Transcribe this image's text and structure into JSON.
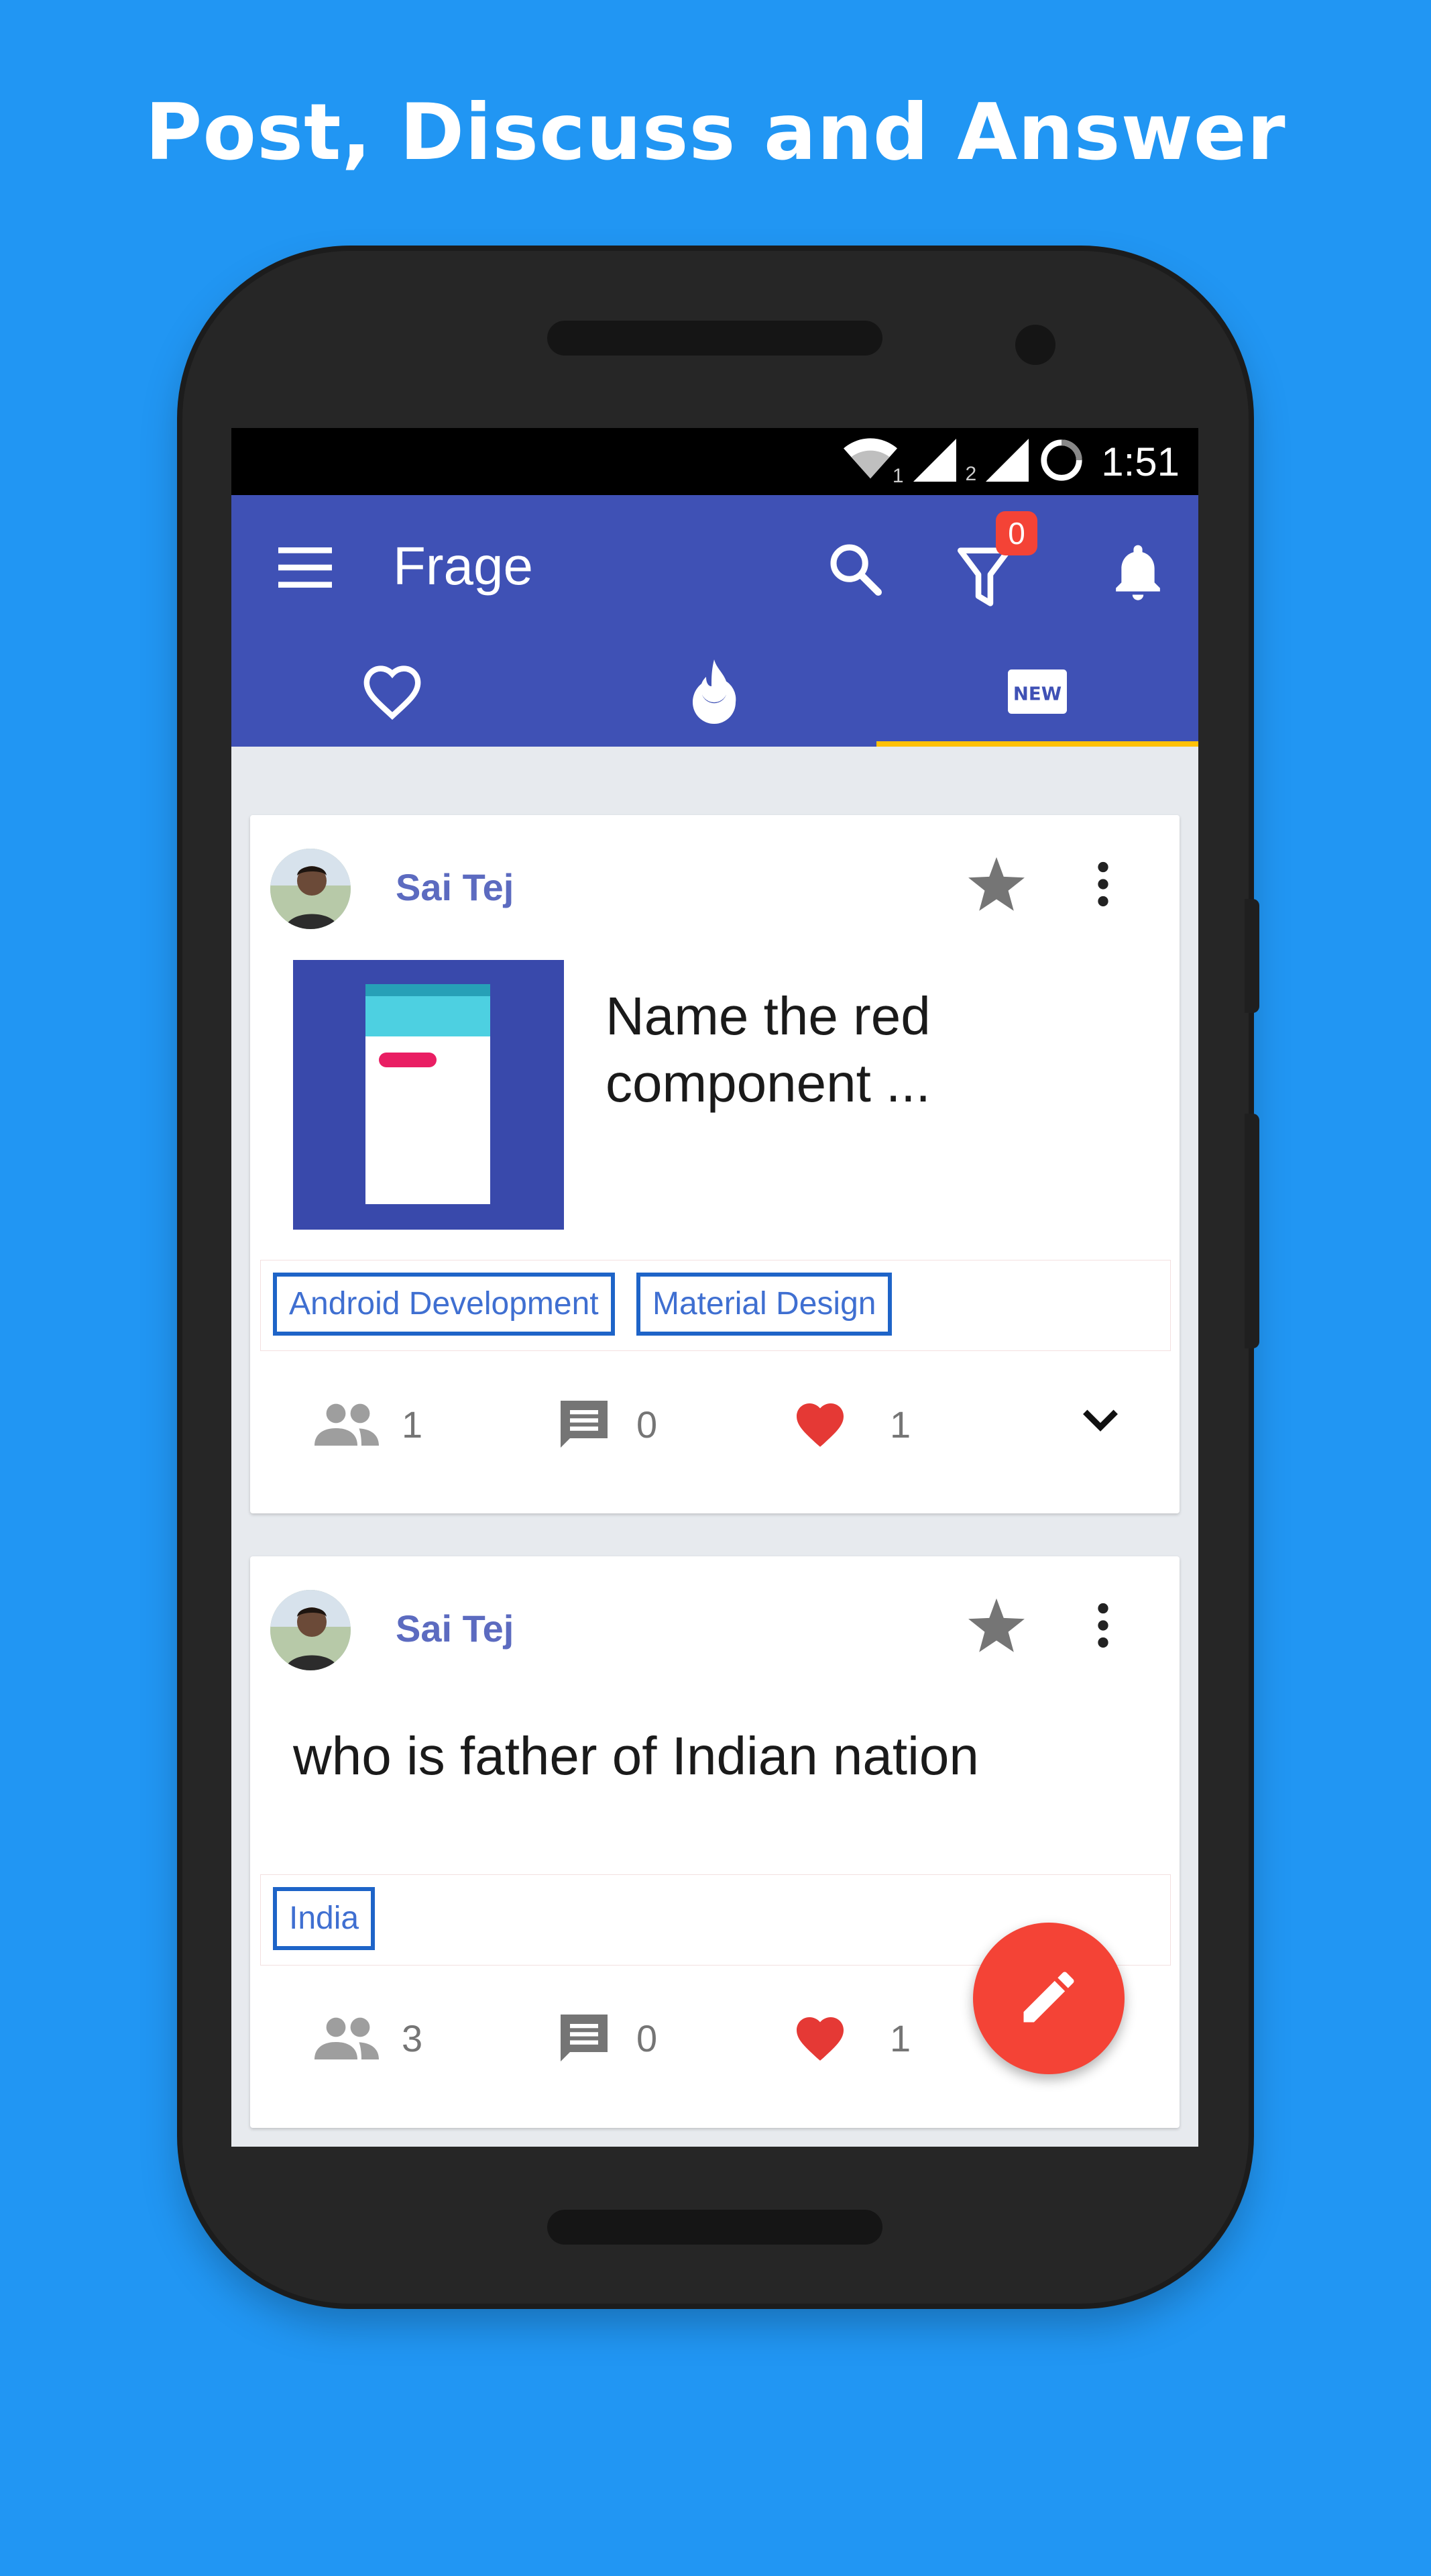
{
  "headline": "Post, Discuss and Answer",
  "status_bar": {
    "wifi_label": "1",
    "sim2_label": "2",
    "time": "1:51"
  },
  "toolbar": {
    "title": "Frage",
    "filter_badge": "0",
    "color": "#3F51B5"
  },
  "tabs": [
    {
      "icon": "heart-outline-icon"
    },
    {
      "icon": "fire-icon"
    },
    {
      "icon": "new-icon",
      "selected": true
    }
  ],
  "posts": [
    {
      "author": "Sai Tej",
      "question": "Name the red component ...",
      "has_image": true,
      "tags": [
        "Android Development",
        "Material Design"
      ],
      "followers": "1",
      "comments": "0",
      "likes": "1"
    },
    {
      "author": "Sai Tej",
      "question": "who is father of Indian nation",
      "has_image": false,
      "tags": [
        "India"
      ],
      "followers": "3",
      "comments": "0",
      "likes": "1"
    }
  ],
  "colors": {
    "background": "#2196F3",
    "accent": "#FFC107",
    "fab": "#F44336",
    "like": "#E53935",
    "tag_border": "#1E64C8"
  }
}
